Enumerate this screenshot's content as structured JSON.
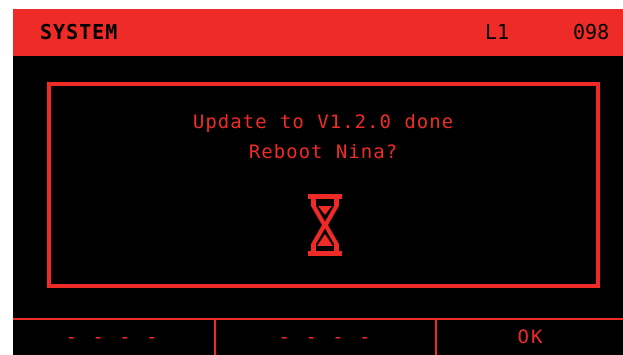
{
  "header": {
    "title": "SYSTEM",
    "level": "L1",
    "number": "098"
  },
  "dialog": {
    "line1": "Update to V1.2.0 done",
    "line2": "Reboot Nina?",
    "icon": "hourglass-icon"
  },
  "softkeys": [
    {
      "label": "- - - -"
    },
    {
      "label": "- - - -"
    },
    {
      "label": "OK"
    }
  ],
  "colors": {
    "accent": "#ee2b27",
    "background": "#000000"
  }
}
